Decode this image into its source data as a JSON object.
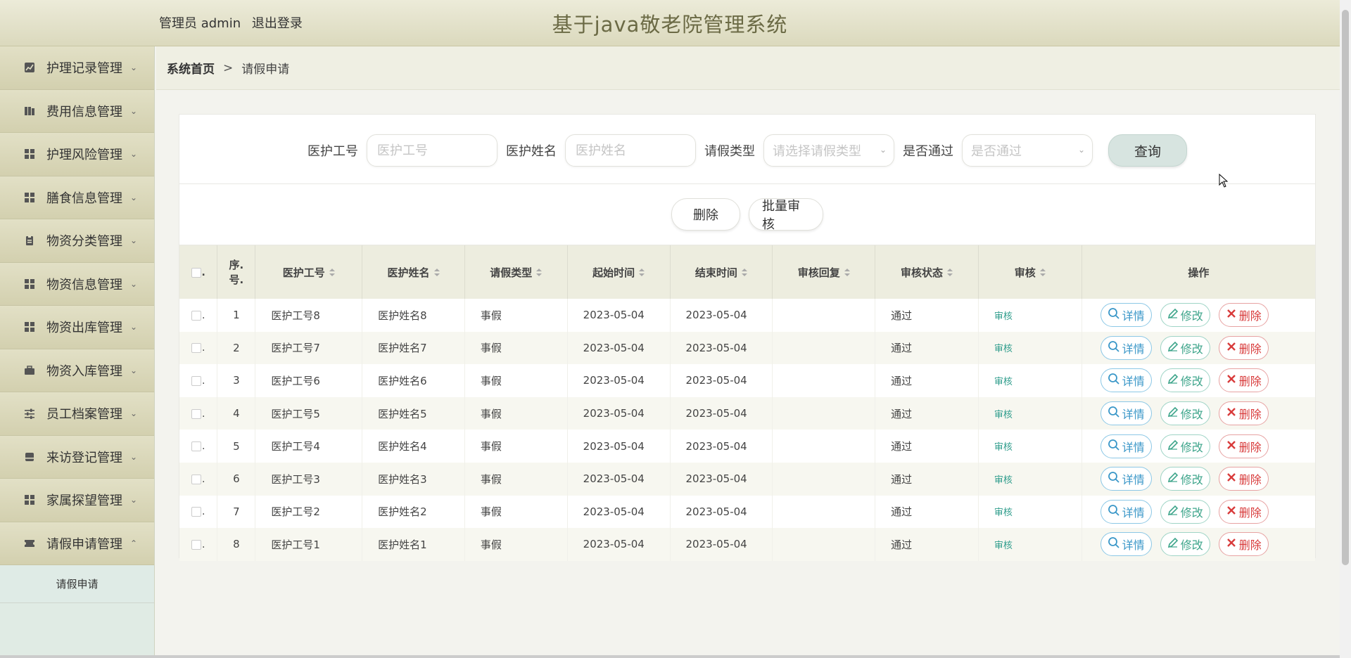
{
  "header": {
    "user_label": "管理员 admin",
    "logout_label": "退出登录",
    "app_title": "基于java敬老院管理系统"
  },
  "sidebar": {
    "items": [
      {
        "label": "护理记录管理",
        "icon": "chart-icon"
      },
      {
        "label": "费用信息管理",
        "icon": "book-icon"
      },
      {
        "label": "护理风险管理",
        "icon": "grid-icon"
      },
      {
        "label": "膳食信息管理",
        "icon": "grid-icon"
      },
      {
        "label": "物资分类管理",
        "icon": "clipboard-icon"
      },
      {
        "label": "物资信息管理",
        "icon": "grid-icon"
      },
      {
        "label": "物资出库管理",
        "icon": "grid-icon"
      },
      {
        "label": "物资入库管理",
        "icon": "briefcase-icon"
      },
      {
        "label": "员工档案管理",
        "icon": "sliders-icon"
      },
      {
        "label": "来访登记管理",
        "icon": "box-icon"
      },
      {
        "label": "家属探望管理",
        "icon": "grid-icon"
      },
      {
        "label": "请假申请管理",
        "icon": "ticket-icon"
      }
    ],
    "sub_item": "请假申请"
  },
  "breadcrumb": {
    "home": "系统首页",
    "separator": ">",
    "current": "请假申请"
  },
  "search": {
    "staff_id_label": "医护工号",
    "staff_id_placeholder": "医护工号",
    "staff_name_label": "医护姓名",
    "staff_name_placeholder": "医护姓名",
    "leave_type_label": "请假类型",
    "leave_type_placeholder": "请选择请假类型",
    "approved_label": "是否通过",
    "approved_placeholder": "是否通过",
    "query_label": "查询"
  },
  "actions": {
    "delete_label": "删除",
    "batch_audit_label": "批量审核"
  },
  "table": {
    "headers": {
      "seq_line1": "序.",
      "seq_line2": "号.",
      "staff_id": "医护工号",
      "staff_name": "医护姓名",
      "leave_type": "请假类型",
      "start": "起始时间",
      "end": "结束时间",
      "reply": "审核回复",
      "status": "审核状态",
      "audit": "审核",
      "ops": "操作"
    },
    "op_labels": {
      "detail": "详情",
      "edit": "修改",
      "delete": "删除"
    },
    "rows": [
      {
        "seq": "1",
        "staff_id": "医护工号8",
        "staff_name": "医护姓名8",
        "type": "事假",
        "start": "2023-05-04",
        "end": "2023-05-04",
        "reply": "",
        "status": "通过",
        "audit": "审核"
      },
      {
        "seq": "2",
        "staff_id": "医护工号7",
        "staff_name": "医护姓名7",
        "type": "事假",
        "start": "2023-05-04",
        "end": "2023-05-04",
        "reply": "",
        "status": "通过",
        "audit": "审核"
      },
      {
        "seq": "3",
        "staff_id": "医护工号6",
        "staff_name": "医护姓名6",
        "type": "事假",
        "start": "2023-05-04",
        "end": "2023-05-04",
        "reply": "",
        "status": "通过",
        "audit": "审核"
      },
      {
        "seq": "4",
        "staff_id": "医护工号5",
        "staff_name": "医护姓名5",
        "type": "事假",
        "start": "2023-05-04",
        "end": "2023-05-04",
        "reply": "",
        "status": "通过",
        "audit": "审核"
      },
      {
        "seq": "5",
        "staff_id": "医护工号4",
        "staff_name": "医护姓名4",
        "type": "事假",
        "start": "2023-05-04",
        "end": "2023-05-04",
        "reply": "",
        "status": "通过",
        "audit": "审核"
      },
      {
        "seq": "6",
        "staff_id": "医护工号3",
        "staff_name": "医护姓名3",
        "type": "事假",
        "start": "2023-05-04",
        "end": "2023-05-04",
        "reply": "",
        "status": "通过",
        "audit": "审核"
      },
      {
        "seq": "7",
        "staff_id": "医护工号2",
        "staff_name": "医护姓名2",
        "type": "事假",
        "start": "2023-05-04",
        "end": "2023-05-04",
        "reply": "",
        "status": "通过",
        "audit": "审核"
      },
      {
        "seq": "8",
        "staff_id": "医护工号1",
        "staff_name": "医护姓名1",
        "type": "事假",
        "start": "2023-05-04",
        "end": "2023-05-04",
        "reply": "",
        "status": "通过",
        "audit": "审核"
      }
    ]
  },
  "colors": {
    "header_bg": "#dbd9bd",
    "title": "#6b6a45",
    "detail": "#3a97c8",
    "edit": "#3ea58b",
    "delete": "#d83b3b",
    "audit_link": "#2f9d8c"
  }
}
